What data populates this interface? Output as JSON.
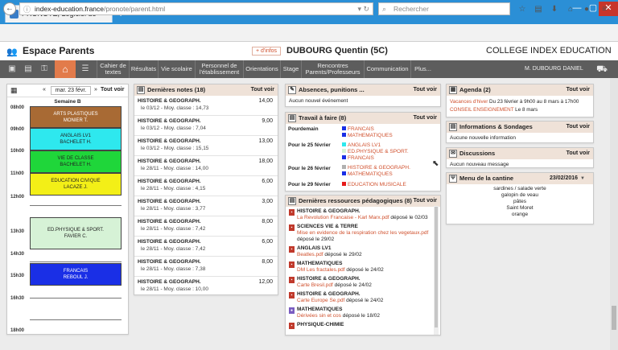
{
  "browser": {
    "tab_title": "PRONOTE, Logiciel de gest...",
    "new_tab": "+",
    "url_host": "index-education.france",
    "url_path": "/pronote/parent.html",
    "search_placeholder": "Rechercher",
    "window_buttons": [
      "—",
      "▢",
      "✕"
    ]
  },
  "header": {
    "space": "Espace Parents",
    "infos": "+ d'infos",
    "student": "DUBOURG Quentin (5C)",
    "school": "COLLEGE INDEX EDUCATION"
  },
  "menu": {
    "items": [
      "Cahier de textes",
      "Résultats",
      "Vie scolaire",
      "Personnel de l'établissement",
      "Orientations",
      "Stage",
      "Rencontres Parents/Professeurs",
      "Communication",
      "Plus..."
    ],
    "user": "M. DUBOURG DANIEL"
  },
  "timetable": {
    "date": "mar. 23 févr.",
    "tout_voir": "Tout voir",
    "week": "Semaine B",
    "hours": [
      "08h00",
      "09h00",
      "10h00",
      "11h00",
      "12h00",
      "13h30",
      "14h30",
      "15h30",
      "16h30",
      "18h00"
    ],
    "slots": [
      {
        "subject": "ARTS PLASTIQUES",
        "teacher": "MONIER T.",
        "color": "#a86a34"
      },
      {
        "subject": "ANGLAIS LV1",
        "teacher": "BACHELET H.",
        "color": "#2ee8ee"
      },
      {
        "subject": "VIE DE CLASSE",
        "teacher": "BACHELET H.",
        "color": "#1fd63a"
      },
      {
        "subject": "EDUCATION CIVIQUE",
        "teacher": "LACAZE J.",
        "color": "#f3ef17"
      },
      {
        "subject": "ED.PHYSIQUE & SPORT.",
        "teacher": "FAVIER C.",
        "color": "#d6f2d6"
      },
      {
        "subject": "FRANCAIS",
        "teacher": "REBOUL J.",
        "color": "#1a2fe6"
      }
    ]
  },
  "notes": {
    "title": "Dernières notes (18)",
    "tout_voir": "Tout voir",
    "rows": [
      {
        "subject": "HISTOIRE & GEOGRAPH.",
        "detail": "le 03/12  -  Moy. classe : 14,73",
        "grade": "14,00"
      },
      {
        "subject": "HISTOIRE & GEOGRAPH.",
        "detail": "le 03/12  -  Moy. classe : 7,04",
        "grade": "9,00"
      },
      {
        "subject": "HISTOIRE & GEOGRAPH.",
        "detail": "le 03/12  -  Moy. classe : 15,15",
        "grade": "13,00"
      },
      {
        "subject": "HISTOIRE & GEOGRAPH.",
        "detail": "le 28/11  -  Moy. classe : 14,00",
        "grade": "18,00"
      },
      {
        "subject": "HISTOIRE & GEOGRAPH.",
        "detail": "le 28/11  -  Moy. classe : 4,15",
        "grade": "6,00"
      },
      {
        "subject": "HISTOIRE & GEOGRAPH.",
        "detail": "le 28/11  -  Moy. classe : 3,77",
        "grade": "3,00"
      },
      {
        "subject": "HISTOIRE & GEOGRAPH.",
        "detail": "le 28/11  -  Moy. classe : 7,42",
        "grade": "8,00"
      },
      {
        "subject": "HISTOIRE & GEOGRAPH.",
        "detail": "le 28/11  -  Moy. classe : 7,42",
        "grade": "6,00"
      },
      {
        "subject": "HISTOIRE & GEOGRAPH.",
        "detail": "le 28/11  -  Moy. classe : 7,38",
        "grade": "8,00"
      },
      {
        "subject": "HISTOIRE & GEOGRAPH.",
        "detail": "le 28/11  -  Moy. classe : 10,00",
        "grade": "12,00"
      }
    ]
  },
  "absences": {
    "title": "Absences, punitions ...",
    "tout_voir": "Tout voir",
    "text": "Aucun nouvel événement"
  },
  "travail": {
    "title": "Travail à faire (8)",
    "tout_voir": "Tout voir",
    "groups": [
      {
        "day": "Pourdemain",
        "items": [
          {
            "label": "FRANCAIS",
            "color": "#1a2fe6"
          },
          {
            "label": "MATHEMATIQUES",
            "color": "#1a2fe6"
          }
        ]
      },
      {
        "day": "Pour le 25 février",
        "items": [
          {
            "label": "ANGLAIS LV1",
            "color": "#2ee8ee"
          },
          {
            "label": "ED.PHYSIQUE & SPORT.",
            "color": "#d6f2d6"
          },
          {
            "label": "FRANCAIS",
            "color": "#1a2fe6"
          }
        ]
      },
      {
        "day": "Pour le 26 février",
        "items": [
          {
            "label": "HISTOIRE & GEOGRAPH.",
            "color": "#b0b0b0"
          },
          {
            "label": "MATHEMATIQUES",
            "color": "#1a2fe6"
          }
        ]
      },
      {
        "day": "Pour le 29 février",
        "items": [
          {
            "label": "EDUCATION MUSICALE",
            "color": "#e61a1a"
          }
        ]
      }
    ]
  },
  "ressources": {
    "title": "Dernières ressources pédagogiques (8)",
    "tout_voir": "Tout voir",
    "items": [
      {
        "subject": "HISTOIRE & GEOGRAPH.",
        "file": "La Revolution Francaise - Karl Marx.pdf",
        "posted": "déposé le 02/03"
      },
      {
        "subject": "SCIENCES VIE & TERRE",
        "file": "Mise en evidence de la respiration chez les vegetaux.pdf",
        "posted": "déposé le 29/02"
      },
      {
        "subject": "ANGLAIS LV1",
        "file": "Beatles.pdf",
        "posted": "déposé le 29/02"
      },
      {
        "subject": "MATHEMATIQUES",
        "file": "DM Les fractales.pdf",
        "posted": "déposé le 24/02"
      },
      {
        "subject": "HISTOIRE & GEOGRAPH.",
        "file": "Carte Bresil.pdf",
        "posted": "déposé le 24/02"
      },
      {
        "subject": "HISTOIRE & GEOGRAPH.",
        "file": "Carte Europe Se.pdf",
        "posted": "déposé le 24/02"
      },
      {
        "subject": "MATHEMATIQUES",
        "file": "Dérivées sin et cos",
        "posted": "déposé le 18/02"
      },
      {
        "subject": "PHYSIQUE-CHIMIE",
        "file": "",
        "posted": ""
      }
    ]
  },
  "agenda": {
    "title": "Agenda (2)",
    "tout_voir": "Tout voir",
    "items": [
      {
        "label": "Vacances d'hiver",
        "text": " Du 23 février à 9h00 au 8 mars à 17h00"
      },
      {
        "label": "CONSEIL ENSEIGNEMENT",
        "text": " Le 8 mars"
      }
    ]
  },
  "infos_sondages": {
    "title": "Informations & Sondages",
    "tout_voir": "Tout voir",
    "text": "Aucune nouvelle information"
  },
  "discussions": {
    "title": "Discussions",
    "tout_voir": "Tout voir",
    "text": "Aucun nouveau message"
  },
  "cantine": {
    "title": "Menu de la cantine",
    "date": "23/02/2016",
    "tout_voir": "Tout voir",
    "items": [
      "sardines / salade verte",
      "galopin de veau",
      "pâtes",
      "Saint Moret",
      "orange"
    ]
  }
}
